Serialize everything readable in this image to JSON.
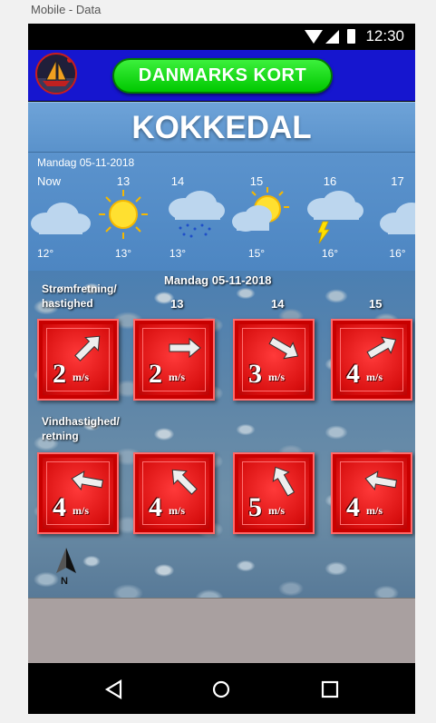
{
  "caption": "Mobile - Data",
  "status_bar": {
    "time": "12:30"
  },
  "header": {
    "logo": "sailboat-logo",
    "map_button_label": "DANMARKS KORT"
  },
  "location_title": "KOKKEDAL",
  "forecast": {
    "date": "Mandag 05-11-2018",
    "columns": [
      {
        "hour": "Now",
        "icon": "cloud",
        "temp": "12°"
      },
      {
        "hour": "13",
        "icon": "sun",
        "temp": "13°"
      },
      {
        "hour": "14",
        "icon": "rain-cloud",
        "temp": "13°"
      },
      {
        "hour": "15",
        "icon": "sun-behind-cloud",
        "temp": "15°"
      },
      {
        "hour": "16",
        "icon": "thunder-cloud",
        "temp": "16°"
      },
      {
        "hour": "17",
        "icon": "cloud",
        "temp": "16°"
      }
    ]
  },
  "water": {
    "date": "Mandag 05-11-2018",
    "hours": [
      "13",
      "14",
      "15"
    ],
    "current": {
      "label_line1": "Strømfretning/",
      "label_line2": "hastighed",
      "tiles": [
        {
          "value": "2",
          "unit": "m/s",
          "direction_deg": 315
        },
        {
          "value": "2",
          "unit": "m/s",
          "direction_deg": 0
        },
        {
          "value": "3",
          "unit": "m/s",
          "direction_deg": 30
        },
        {
          "value": "4",
          "unit": "m/s",
          "direction_deg": 330
        }
      ]
    },
    "wind": {
      "label_line1": "Vindhastighed/",
      "label_line2": "retning",
      "tiles": [
        {
          "value": "4",
          "unit": "m/s",
          "direction_deg": 190
        },
        {
          "value": "4",
          "unit": "m/s",
          "direction_deg": 225
        },
        {
          "value": "5",
          "unit": "m/s",
          "direction_deg": 240
        },
        {
          "value": "4",
          "unit": "m/s",
          "direction_deg": 190
        }
      ]
    },
    "north_marker": "N"
  },
  "nav": {
    "back": "back-icon",
    "home": "home-icon",
    "recents": "recents-icon"
  }
}
